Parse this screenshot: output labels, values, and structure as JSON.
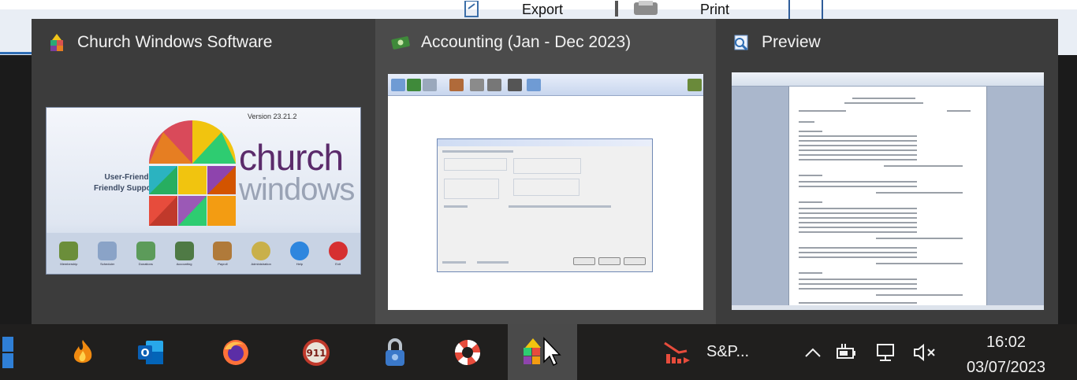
{
  "background_app": {
    "toolbar": {
      "export_label": "Export",
      "print_label": "Print"
    }
  },
  "flyout": {
    "thumbnails": [
      {
        "title": "Church Windows Software",
        "icon": "church-windows-icon"
      },
      {
        "title": "Accounting (Jan - Dec 2023)",
        "icon": "accounting-money-icon"
      },
      {
        "title": "Preview",
        "icon": "preview-icon"
      }
    ],
    "splash": {
      "version": "Version 23.21.2",
      "tagline_1": "User-Friendly,",
      "tagline_2": "Friendly Support",
      "word_1": "church",
      "word_2": "windows",
      "modules": [
        "Membership",
        "Scheduler",
        "Donations",
        "Accounting",
        "Payroll",
        "Administration",
        "Help",
        "Exit"
      ]
    }
  },
  "taskbar": {
    "pinned": [
      {
        "name": "start-button-icon"
      },
      {
        "name": "flame-app-icon"
      },
      {
        "name": "outlook-icon"
      },
      {
        "name": "firefox-icon"
      },
      {
        "name": "emergency-911-icon"
      },
      {
        "name": "padlock-app-icon"
      },
      {
        "name": "lifebuoy-support-icon"
      },
      {
        "name": "church-windows-taskbar-icon"
      }
    ],
    "sp_label": "S&P...",
    "tray": {
      "chevron": "^",
      "icons": [
        "battery-icon",
        "network-icon",
        "volume-muted-icon"
      ]
    },
    "clock": {
      "time": "16:02",
      "date": "03/07/2023"
    }
  },
  "colors": {
    "taskbar_bg": "#201f1e",
    "flyout_bg": "#3c3c3c",
    "active_item": "#4a4a4a"
  }
}
